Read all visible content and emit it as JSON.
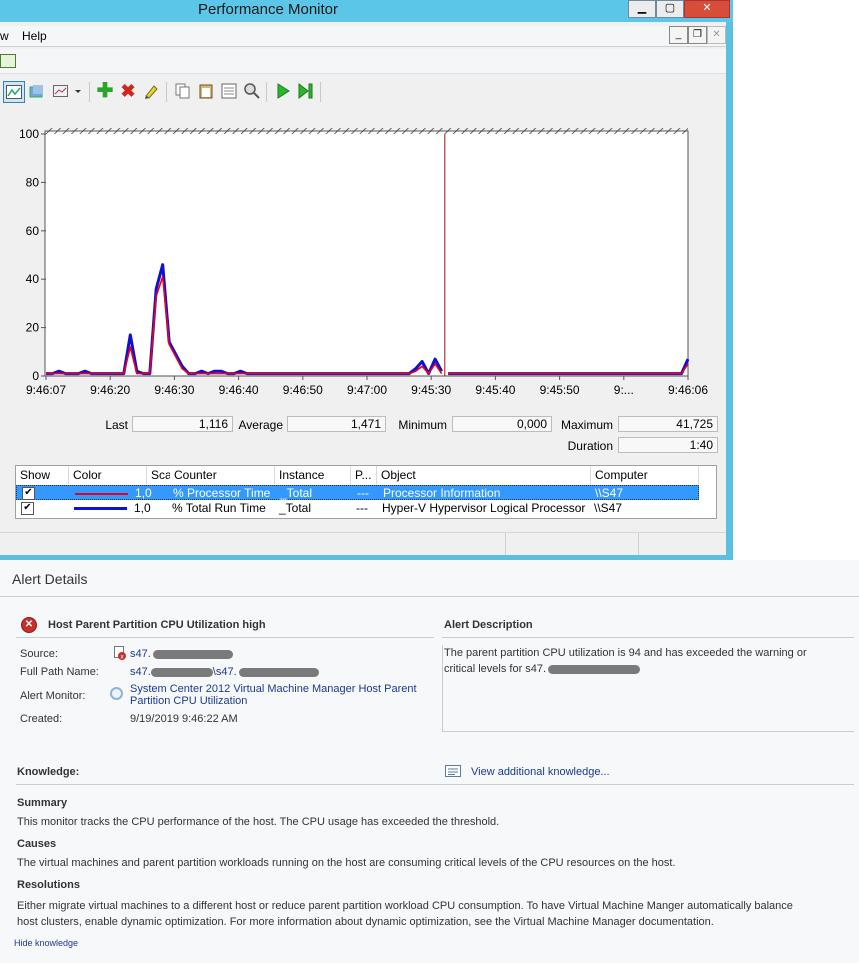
{
  "window": {
    "title": "Performance Monitor",
    "menu": [
      "w",
      "Help"
    ]
  },
  "chart_data": {
    "type": "line",
    "ylim": [
      0,
      100
    ],
    "yticks": [
      0,
      20,
      40,
      60,
      80,
      100
    ],
    "x_tick_labels": [
      "9:46:07",
      "9:46:20",
      "9:46:30",
      "9:46:40",
      "9:46:50",
      "9:47:00",
      "9:45:30",
      "9:45:40",
      "9:45:50",
      "9:...",
      "9:46:06"
    ],
    "x": [
      0,
      1,
      2,
      3,
      4,
      5,
      6,
      7,
      8,
      9,
      10,
      11,
      12,
      13,
      14,
      15,
      16,
      17,
      18,
      19,
      20,
      21,
      22,
      23,
      24,
      25,
      26,
      27,
      28,
      29,
      30,
      31,
      32,
      33,
      34,
      35,
      36,
      37,
      38,
      39,
      40,
      41,
      42,
      43,
      44,
      45,
      46,
      47,
      48,
      49,
      50,
      51,
      52,
      53,
      54,
      55,
      56,
      57,
      58,
      59,
      60,
      61,
      62,
      63,
      64,
      65,
      66,
      67,
      68,
      69,
      70,
      71,
      72,
      73,
      74,
      75,
      76,
      77,
      78,
      79,
      80,
      81,
      82,
      83,
      84,
      85,
      86,
      87,
      88,
      89,
      90,
      91,
      92,
      93,
      94,
      95,
      96,
      97,
      98,
      99
    ],
    "current_position_index": 62,
    "series": [
      {
        "name": "% Processor Time",
        "color": "#e8001c",
        "values": [
          1,
          1,
          1,
          1,
          1,
          1,
          1,
          1,
          1,
          1,
          1,
          1,
          1,
          12,
          1,
          1,
          1,
          33,
          41,
          13,
          8,
          3,
          1,
          1,
          1,
          1,
          1,
          1,
          1,
          1,
          1,
          1,
          1,
          1,
          1,
          1,
          1,
          1,
          1,
          1,
          1,
          1,
          1,
          1,
          1,
          1,
          1,
          1,
          1,
          1,
          1,
          1,
          1,
          1,
          1,
          1,
          1,
          2,
          4,
          1,
          5,
          1,
          1,
          1,
          1,
          1,
          1,
          1,
          1,
          1,
          1,
          1,
          1,
          1,
          1,
          1,
          1,
          1,
          1,
          1,
          1,
          1,
          1,
          1,
          1,
          1,
          1,
          1,
          1,
          1,
          1,
          1,
          1,
          1,
          1,
          1,
          1,
          1,
          1,
          5
        ]
      },
      {
        "name": "% Total Run Time",
        "color": "#1010d0",
        "values": [
          1,
          1,
          2,
          1,
          1,
          1,
          2,
          1,
          1,
          1,
          1,
          1,
          1,
          17,
          2,
          1,
          1,
          36,
          46,
          14,
          9,
          4,
          1,
          1,
          2,
          1,
          2,
          2,
          1,
          1,
          2,
          1,
          1,
          1,
          1,
          1,
          1,
          1,
          1,
          1,
          1,
          1,
          1,
          1,
          1,
          1,
          1,
          1,
          1,
          1,
          1,
          1,
          1,
          1,
          1,
          1,
          1,
          3,
          6,
          1,
          7,
          2,
          1,
          1,
          1,
          1,
          1,
          1,
          1,
          1,
          1,
          1,
          1,
          1,
          1,
          1,
          1,
          1,
          1,
          1,
          1,
          1,
          1,
          1,
          1,
          1,
          1,
          1,
          1,
          1,
          1,
          1,
          1,
          1,
          1,
          1,
          1,
          1,
          1,
          7
        ]
      }
    ]
  },
  "stats": {
    "last_label": "Last",
    "last": "1,116",
    "average_label": "Average",
    "average": "1,471",
    "minimum_label": "Minimum",
    "minimum": "0,000",
    "maximum_label": "Maximum",
    "maximum": "41,725",
    "duration_label": "Duration",
    "duration": "1:40"
  },
  "counters": {
    "headers": [
      "Show",
      "Color",
      "Scale",
      "Counter",
      "Instance",
      "P...",
      "Object",
      "Computer"
    ],
    "rows": [
      {
        "show": "✔",
        "color": "#e8001c",
        "scale": "1,0",
        "counter": "% Processor Time",
        "instance": "_Total",
        "parent": "---",
        "object": "Processor Information",
        "computer": "\\\\S47"
      },
      {
        "show": "✔",
        "color": "#1010d0",
        "scale": "1,0",
        "counter": "% Total Run Time",
        "instance": "_Total",
        "parent": "---",
        "object": "Hyper-V Hypervisor Logical Processor",
        "computer": "\\\\S47"
      }
    ]
  },
  "alert": {
    "section_title": "Alert Details",
    "name": "Host Parent Partition CPU Utilization high",
    "source_label": "Source:",
    "source": "s47.",
    "full_path_label": "Full Path Name:",
    "full_path_a": "s47.",
    "full_path_b": "\\s47.",
    "monitor_label": "Alert Monitor:",
    "monitor_line1": "System Center 2012 Virtual Machine Manager Host Parent",
    "monitor_line2": "Partition CPU Utilization",
    "created_label": "Created:",
    "created": "9/19/2019 9:46:22 AM",
    "description_title": "Alert Description",
    "description_line1": "The parent partition CPU utilization is 94 and has exceeded the warning or",
    "description_line2": "critical levels for s47.",
    "knowledge_label": "Knowledge:",
    "view_knowledge": "View additional knowledge...",
    "summary_title": "Summary",
    "summary": "This monitor tracks the CPU performance of the host. The CPU usage has exceeded the threshold.",
    "causes_title": "Causes",
    "causes": "The virtual machines and parent partition workloads running on the host are consuming critical levels of the CPU resources on the host.",
    "resolutions_title": "Resolutions",
    "resolutions_line1": "Either migrate virtual machines to a different host or reduce parent partition workload CPU consumption. To have Virtual Machine Manger automatically balance",
    "resolutions_line2": "host clusters, enable dynamic optimization. For more information about dynamic optimization, see the Virtual Machine Manager documentation.",
    "hide_knowledge": "Hide knowledge"
  }
}
